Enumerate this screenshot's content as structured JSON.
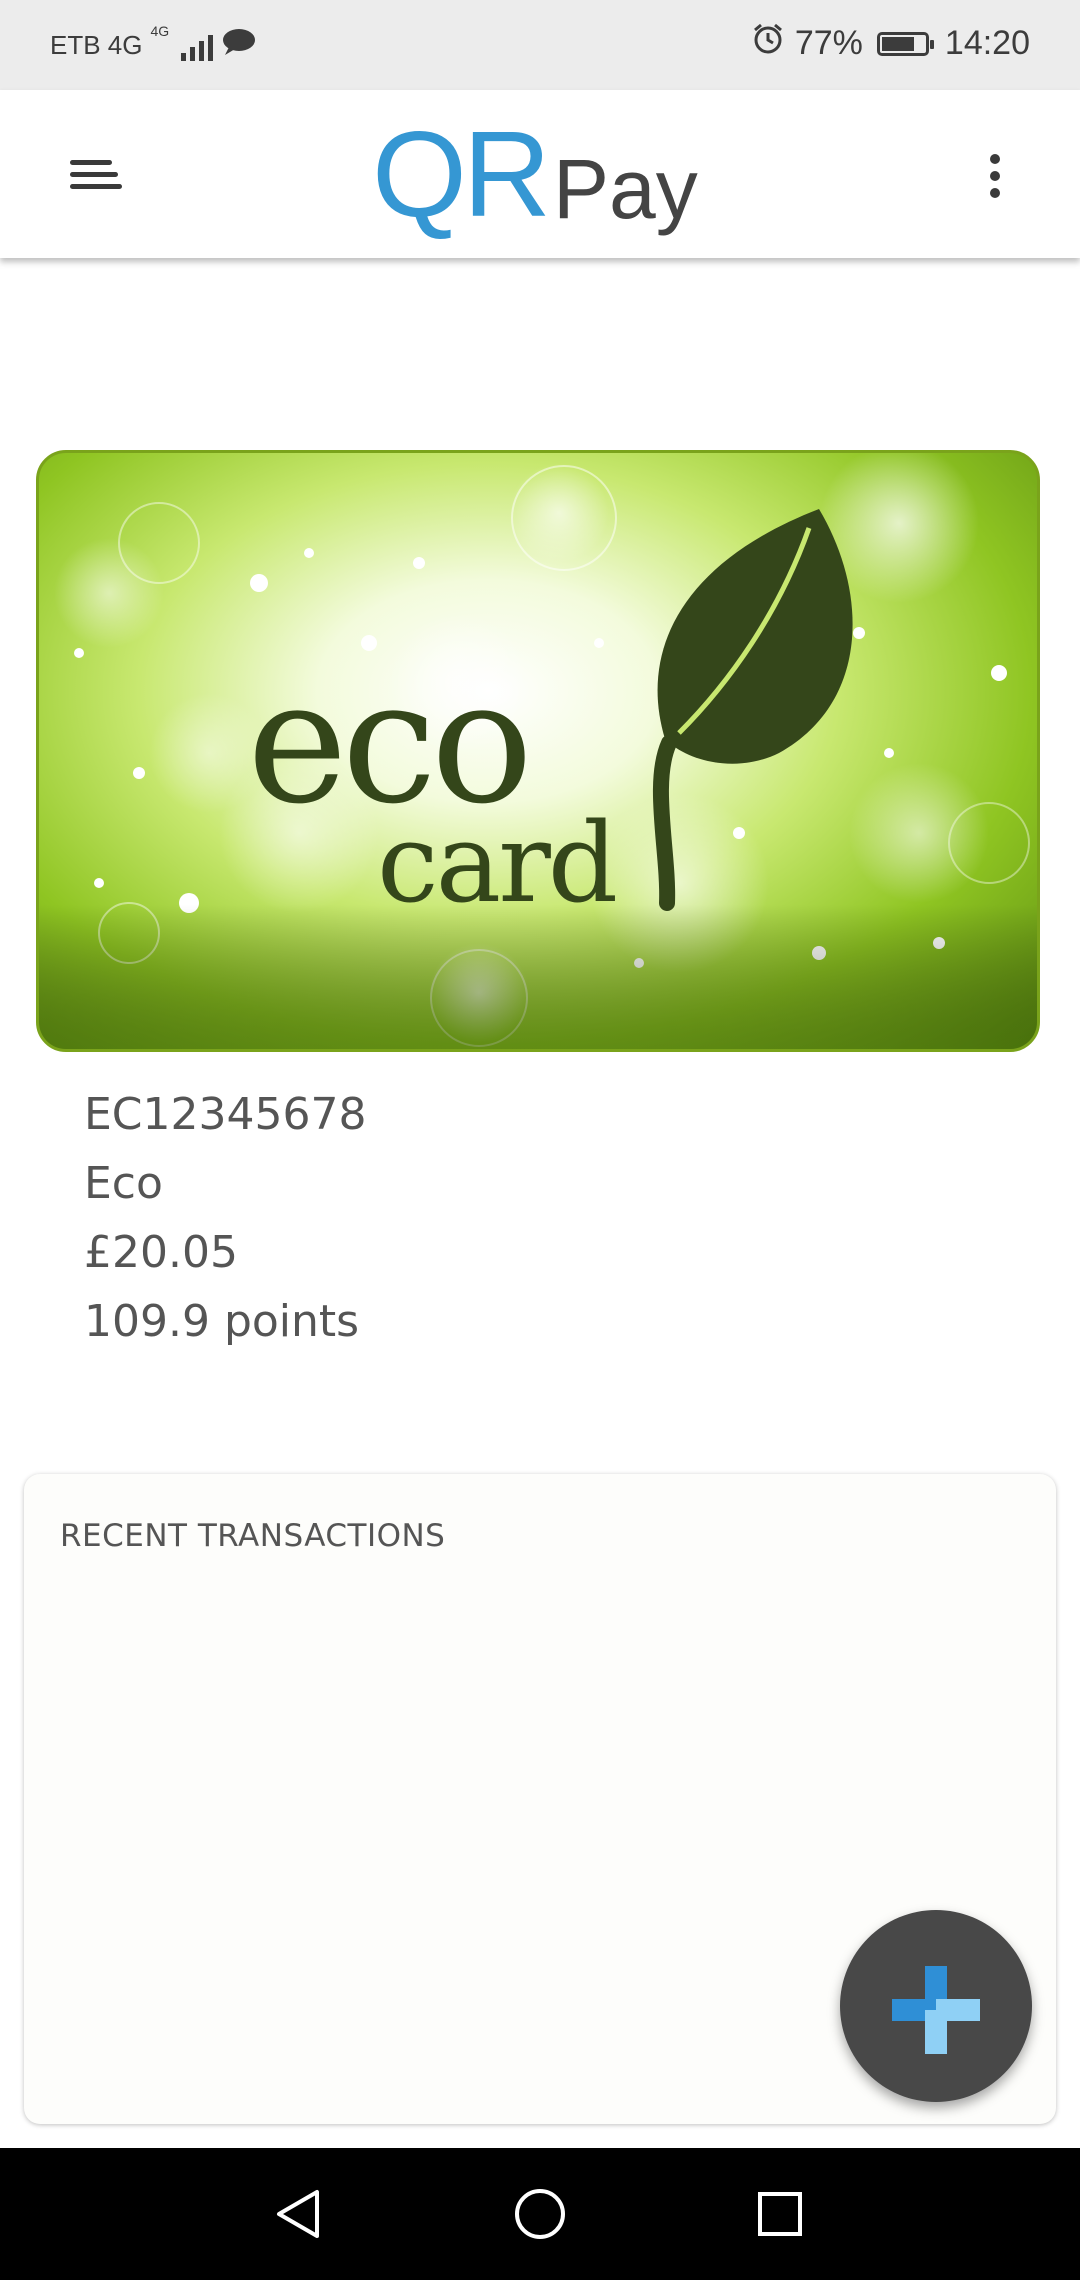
{
  "status_bar": {
    "carrier": "ETB 4G",
    "network_badge": "4G",
    "battery_percent": "77%",
    "battery_level": 0.77,
    "time": "14:20",
    "icons": [
      "signal-icon",
      "message-icon",
      "alarm-icon",
      "battery-icon"
    ]
  },
  "app_bar": {
    "logo_qr": "QR",
    "logo_pay": "Pay",
    "menu_icon": "hamburger-menu-icon",
    "overflow_icon": "more-vert-icon"
  },
  "card": {
    "brand_line1": "eco",
    "brand_line2": "card",
    "number": "EC12345678",
    "type": "Eco",
    "balance": "£20.05",
    "points": "109.9 points"
  },
  "transactions": {
    "title": "RECENT TRANSACTIONS",
    "items": []
  },
  "fab": {
    "icon": "plus-icon"
  },
  "nav_bar": {
    "icons": [
      "back-icon",
      "home-icon",
      "recents-icon"
    ]
  },
  "colors": {
    "brand_blue": "#3597d3",
    "fab_plus_blue": "#2f8fd6",
    "fab_plus_light": "#8fd0f5",
    "card_green": "#8fc522",
    "leaf_dark": "#34461a"
  }
}
